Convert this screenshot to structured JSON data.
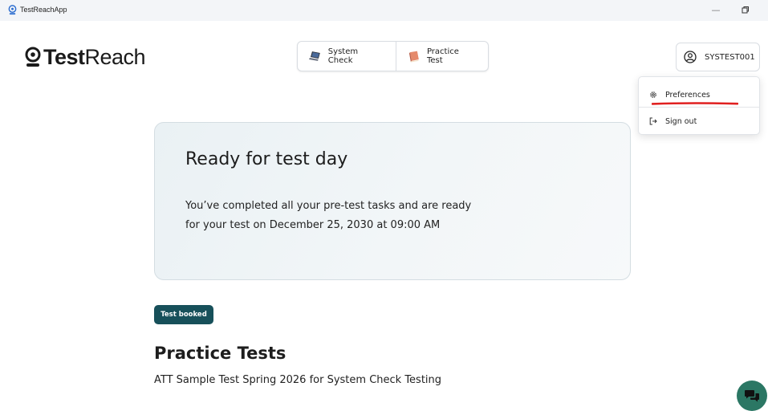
{
  "window": {
    "title": "TestReachApp",
    "minimize_glyph": "—"
  },
  "logo": {
    "bold": "Test",
    "light": "Reach"
  },
  "topnav": {
    "system_check": "System Check",
    "practice_test": "Practice Test"
  },
  "user": {
    "name": "SYSTEST001"
  },
  "menu": {
    "preferences": "Preferences",
    "sign_out": "Sign out",
    "highlight_color": "#e02020"
  },
  "ready_card": {
    "title": "Ready for test day",
    "body": "You’ve completed all your pre-test tasks and are ready for your test on December 25, 2030 at 09:00 AM"
  },
  "badge": {
    "label": "Test booked",
    "color": "#17505a"
  },
  "practice": {
    "heading": "Practice Tests",
    "test_name": "ATT Sample Test Spring 2026 for System Check Testing"
  },
  "chat": {
    "icon": "chat-bubbles-icon",
    "color": "#2b7764"
  }
}
